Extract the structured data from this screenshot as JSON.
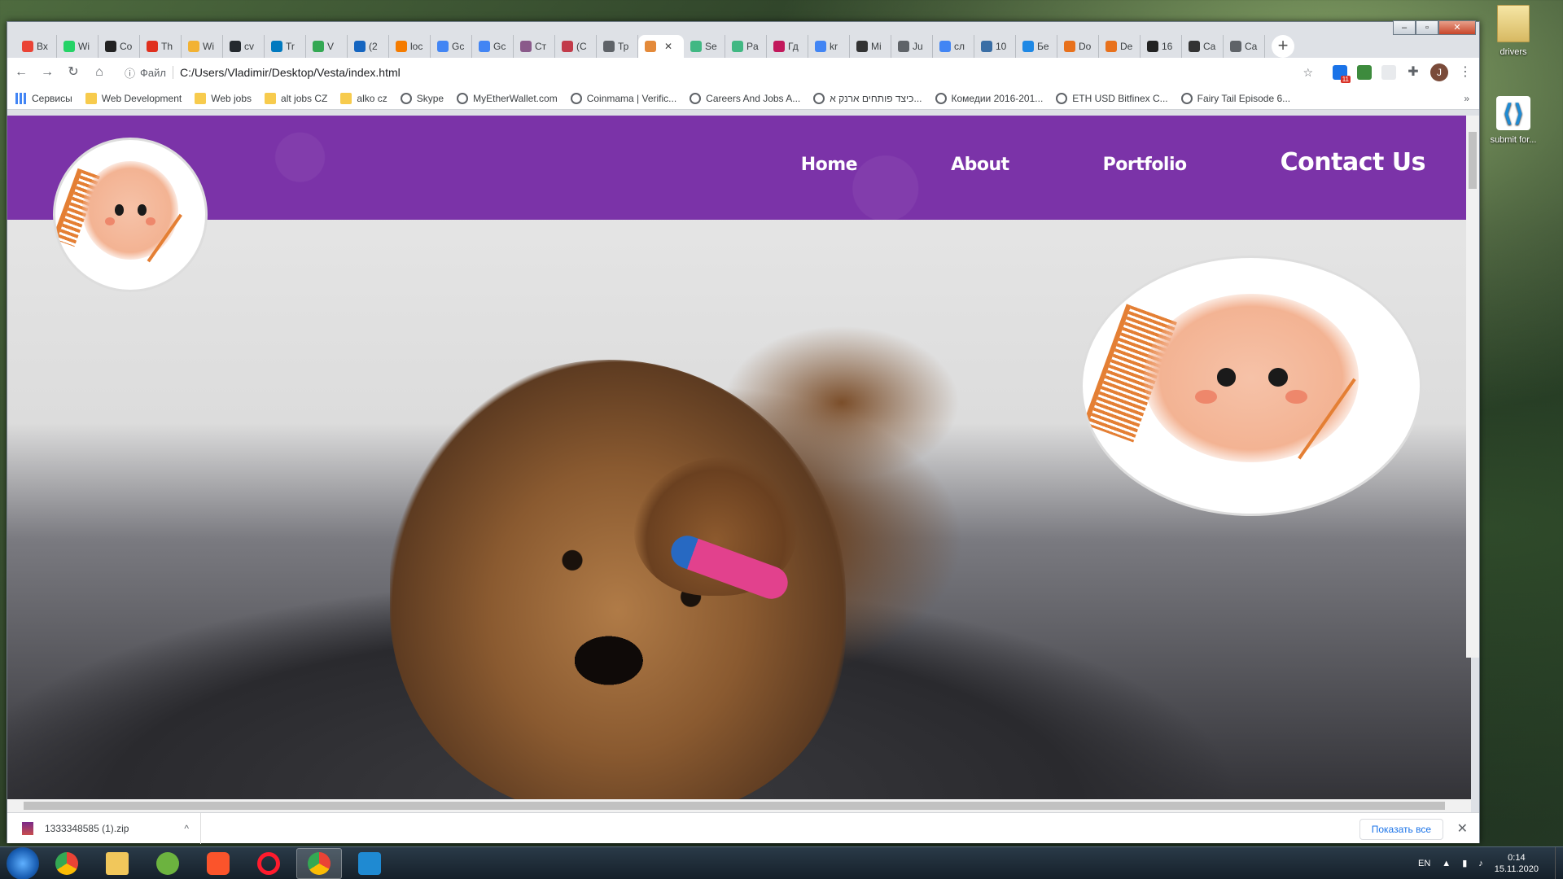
{
  "desktop": {
    "icons": [
      {
        "label": "drivers"
      },
      {
        "label": "submit for..."
      }
    ]
  },
  "browser": {
    "tabs": [
      {
        "label": "Вх",
        "icon": "gmail-icon",
        "color": "#ea4335"
      },
      {
        "label": "Wi",
        "icon": "whatsapp-icon",
        "color": "#25d366"
      },
      {
        "label": "Co",
        "icon": "codewars-icon",
        "color": "#222222"
      },
      {
        "label": "Th",
        "icon": "thinkific-icon",
        "color": "#e0301e"
      },
      {
        "label": "Wi",
        "icon": "wizard-icon",
        "color": "#f2b233"
      },
      {
        "label": "cv",
        "icon": "github-icon",
        "color": "#24292e"
      },
      {
        "label": "Tr",
        "icon": "trello-icon",
        "color": "#0079bf"
      },
      {
        "label": "V",
        "icon": "green-square-icon",
        "color": "#34a853"
      },
      {
        "label": "(2",
        "icon": "mail-icon",
        "color": "#1565c0"
      },
      {
        "label": "loc",
        "icon": "orange-icon",
        "color": "#f57c00"
      },
      {
        "label": "Gc",
        "icon": "google-translate-icon",
        "color": "#4285f4"
      },
      {
        "label": "Gc",
        "icon": "google-translate-icon",
        "color": "#4285f4"
      },
      {
        "label": "Ст",
        "icon": "site-icon",
        "color": "#8a5a8a"
      },
      {
        "label": "(C",
        "icon": "heart-icon",
        "color": "#c23b4a"
      },
      {
        "label": "Тр",
        "icon": "globe-icon",
        "color": "#5f6368"
      },
      {
        "label": "",
        "icon": "vesta-icon",
        "color": "#e48a3a",
        "active": true
      },
      {
        "label": "Se",
        "icon": "vue-icon",
        "color": "#41b883"
      },
      {
        "label": "Pa",
        "icon": "vue-icon",
        "color": "#41b883"
      },
      {
        "label": "Гд",
        "icon": "m-icon",
        "color": "#c2185b"
      },
      {
        "label": "kr",
        "icon": "google-icon",
        "color": "#4285f4"
      },
      {
        "label": "Mi",
        "icon": "brush-icon",
        "color": "#333333"
      },
      {
        "label": "Ju",
        "icon": "globe-icon",
        "color": "#5f6368"
      },
      {
        "label": "сл",
        "icon": "google-icon",
        "color": "#4285f4"
      },
      {
        "label": "10",
        "icon": "robot-icon",
        "color": "#3a6ea5"
      },
      {
        "label": "Бе",
        "icon": "blue-b-icon",
        "color": "#1e88e5"
      },
      {
        "label": "Do",
        "icon": "code-icon",
        "color": "#e8711c"
      },
      {
        "label": "De",
        "icon": "code-icon",
        "color": "#e8711c"
      },
      {
        "label": "16",
        "icon": "f-icon",
        "color": "#222222"
      },
      {
        "label": "Ca",
        "icon": "c-icon",
        "color": "#333333"
      },
      {
        "label": "Ca",
        "icon": "globe-icon",
        "color": "#5f6368"
      }
    ],
    "address": {
      "site_label": "Файл",
      "url": "C:/Users/Vladimir/Desktop/Vesta/index.html"
    },
    "avatar_letter": "J",
    "extension_badge": "11",
    "bookmarks": [
      {
        "label": "Сервисы",
        "type": "apps"
      },
      {
        "label": "Web Development",
        "type": "folder"
      },
      {
        "label": "Web jobs",
        "type": "folder"
      },
      {
        "label": "alt jobs CZ",
        "type": "folder"
      },
      {
        "label": "alko cz",
        "type": "folder"
      },
      {
        "label": "Skype",
        "type": "globe"
      },
      {
        "label": "MyEtherWallet.com",
        "type": "globe"
      },
      {
        "label": "Coinmama | Verific...",
        "type": "globe"
      },
      {
        "label": "Careers And Jobs A...",
        "type": "globe"
      },
      {
        "label": "כיצד פותחים ארנק א...",
        "type": "globe"
      },
      {
        "label": "Комедии 2016-201...",
        "type": "globe"
      },
      {
        "label": "ETH USD Bitfinex C...",
        "type": "globe"
      },
      {
        "label": "Fairy Tail Episode 6...",
        "type": "globe"
      }
    ],
    "bookmarks_more": "»"
  },
  "page": {
    "nav": [
      {
        "label": "Home"
      },
      {
        "label": "About"
      },
      {
        "label": "Portfolio"
      },
      {
        "label": "Contact Us"
      }
    ],
    "brand_color": "#7b33a8"
  },
  "downloads": {
    "file": "1333348585 (1).zip",
    "show_all": "Показать все"
  },
  "taskbar": {
    "lang": "EN",
    "time": "0:14",
    "date": "15.11.2020"
  }
}
